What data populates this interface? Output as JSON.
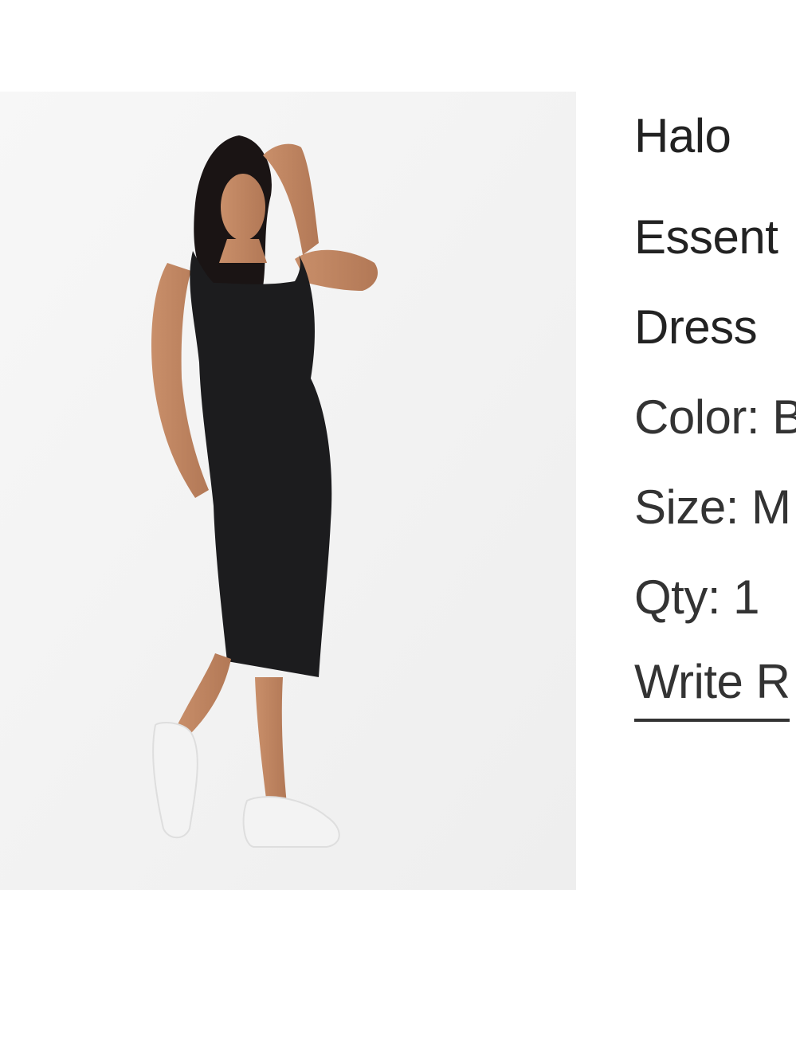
{
  "product": {
    "title_lines": [
      "Halo",
      "Essent",
      "Dress"
    ],
    "color_text": "Color: B",
    "size_text": "Size: M",
    "qty_text": "Qty: 1",
    "review_link_text": "Write R"
  },
  "colors": {
    "photo_background": "#f4f4f4",
    "text": "#333333",
    "dress": "#1c1c1e"
  },
  "icons": {
    "product_image": "model-black-dress-photo"
  }
}
